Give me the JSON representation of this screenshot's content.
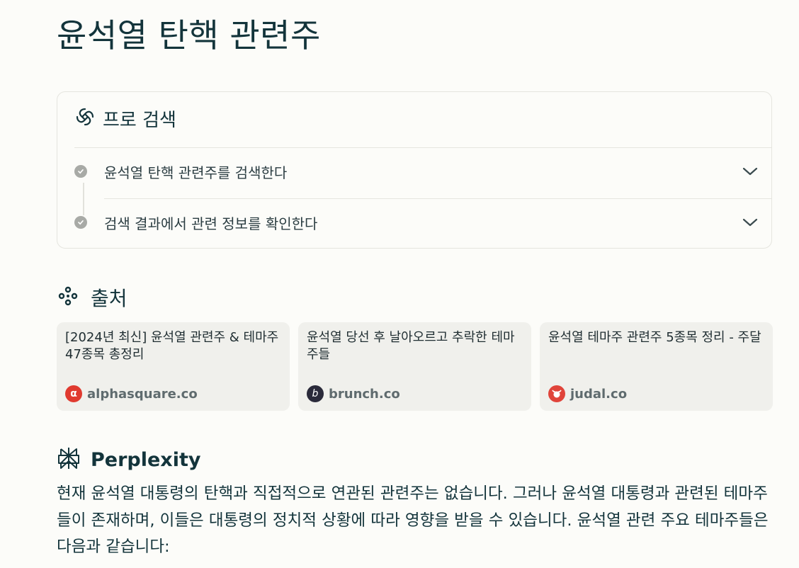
{
  "page": {
    "title": "윤석열 탄핵 관련주"
  },
  "pro_search": {
    "label": "프로 검색",
    "steps": [
      {
        "text": "윤석열 탄핵 관련주를 검색한다"
      },
      {
        "text": "검색 결과에서 관련 정보를 확인한다"
      }
    ]
  },
  "sources": {
    "label": "출처",
    "items": [
      {
        "title": "[2024년 최신] 윤석열 관련주 & 테마주 47종목 총정리",
        "domain": "alphasquare.co",
        "favicon_color": "#e03a2f",
        "favicon_glyph": "α"
      },
      {
        "title": "윤석열 당선 후 날아오르고 추락한 테마주들",
        "domain": "brunch.co",
        "favicon_color": "#2a2a3a",
        "favicon_glyph": "b"
      },
      {
        "title": "윤석열 테마주 관련주 5종목 정리 - 주달",
        "domain": "judal.co",
        "favicon_color": "#e0443a",
        "favicon_glyph": "♉"
      }
    ]
  },
  "answer": {
    "label": "Perplexity",
    "text": "현재 윤석열 대통령의 탄핵과 직접적으로 연관된 관련주는 없습니다. 그러나 윤석열 대통령과 관련된 테마주들이 존재하며, 이들은 대통령의 정치적 상황에 따라 영향을 받을 수 있습니다. 윤석열 관련 주요 테마주들은 다음과 같습니다:"
  },
  "colors": {
    "text": "#13343b",
    "card_bg": "#f0f0ec",
    "page_bg": "#fcfcf9",
    "step_dot": "#a8aaa6"
  }
}
